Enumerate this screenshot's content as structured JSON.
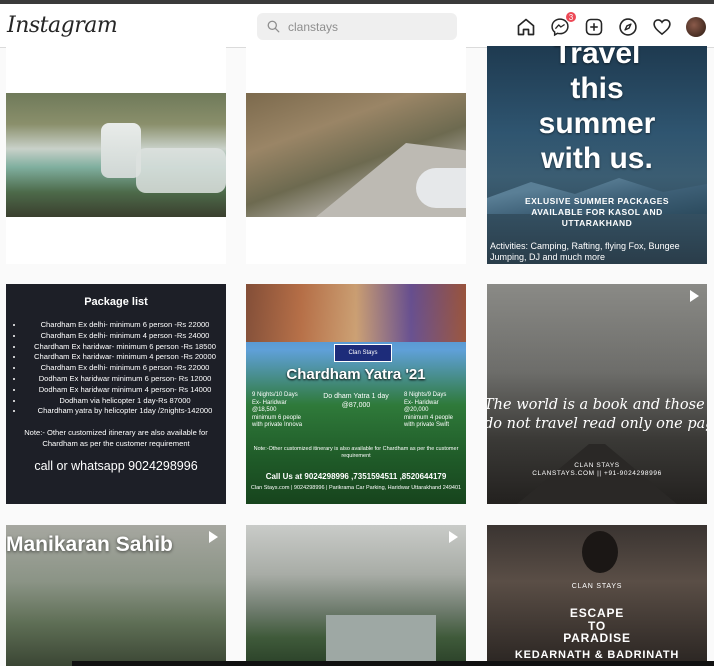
{
  "header": {
    "logo": "Instagram",
    "search": {
      "value": "clanstays",
      "placeholder": "Search"
    },
    "nav": {
      "home": "home-icon",
      "messenger": "messenger-icon",
      "messenger_badge": "3",
      "new_post": "new-post-icon",
      "explore": "explore-icon",
      "activity": "heart-icon",
      "profile": "avatar"
    }
  },
  "posts": {
    "p3": {
      "headline": "Travel\nthis\nsummer\nwith us.",
      "packages": "EXLUSIVE SUMMER PACKAGES\nAVAILABLE FOR KASOL AND\nUTTARAKHAND",
      "activities": "Activities: Camping, Rafting, flying Fox, Bungee\nJumping, DJ and much more"
    },
    "p4": {
      "title": "Package list",
      "items": [
        "Chardham Ex delhi- minimum 6 person -Rs 22000",
        "Chardham Ex delhi- minimum 4 person -Rs 24000",
        "Chardham Ex haridwar- minimum 6 person -Rs 18500",
        "Chardham Ex haridwar- minimum 4 person -Rs 20000",
        "Chardham Ex delhi- minimum 6 person -Rs 22000",
        "Dodham Ex haridwar minimum 6 person- Rs 12000",
        "Dodham Ex haridwar minimum 4 person- Rs 14000",
        "Dodham via helicopter 1 day-Rs 87000",
        "Chardham yatra by helicopter 1day /2nights-142000"
      ],
      "note": "Note:- Other customized itinerary are also available for Chardham as per the customer requirement",
      "call": "call or whatsapp 9024298996"
    },
    "p5": {
      "logo": "Clan Stays",
      "title": "Chardham Yatra '21",
      "left": "9 Nights/10 Days\nEx- Haridwar\n@18,500\nminimum 6 people\nwith private Innova",
      "center": "Do dham Yatra 1 day\n@87,000",
      "right": "8 Nights/9 Days\nEx- Haridwar\n@20,000\nminimum 4 people\nwith private Swift",
      "note": "Note:-Other customized itinerary is also available for Chardham as per the customer requirement",
      "call": "Call Us at 9024298996 ,7351594511 ,8520644179",
      "footer": "Clan Stays.com | 9024298996 | Parikrama Car Parking, Haridwar Uttarakhand 249401"
    },
    "p6": {
      "quote": "The world is a book and those who\ndo not travel read only one page",
      "brand": "CLAN STAYS\nCLANSTAYS.COM || +91-9024298996"
    },
    "p7": {
      "title": "Manikaran Sahib"
    },
    "p9": {
      "brand": "CLAN STAYS",
      "headline": "ESCAPE\nTO\nPARADISE",
      "places": "KEDARNATH & BADRINATH"
    }
  }
}
